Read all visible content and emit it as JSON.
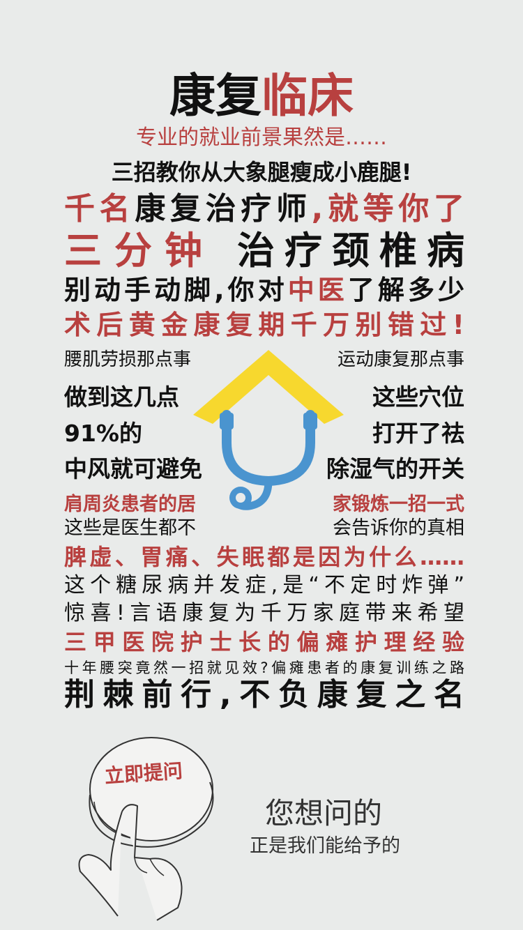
{
  "title": {
    "part1": "康复",
    "part2": "临床"
  },
  "subtitle": "专业的就业前景果然是……",
  "lines": {
    "l1": "三招教你从大象腿瘦成小鹿腿!",
    "l2a": "千名",
    "l2b": "康复治疗师",
    "l2c": ",就等你了",
    "l3a": "三分钟",
    "l3b": "治疗颈椎病",
    "l4a": "别动手动脚,你对",
    "l4b": "中医",
    "l4c": "了解多少",
    "l5": "术后黄金康复期千万别错过!"
  },
  "left_col": {
    "a": "腰肌劳损那点事",
    "b": "做到这几点",
    "c": "91%的",
    "d": "中风就可避免",
    "e": "肩周炎患者的居",
    "f": "这些是医生都不"
  },
  "right_col": {
    "a": "运动康复那点事",
    "b": "这些穴位",
    "c": "打开了祛",
    "d": "除湿气的开关",
    "e": "家锻炼一招一式",
    "f": "会告诉你的真相"
  },
  "lower": {
    "m1": "脾虚、胃痛、失眠都是因为什么……",
    "m2": "这个糖尿病并发症,是“不定时炸弹”",
    "m3": "惊喜!言语康复为千万家庭带来希望",
    "m4": "三甲医院护士长的偏瘫护理经验",
    "m5": "十年腰突竟然一招就见效?偏瘫患者的康复训练之路",
    "m6": "荆棘前行,不负康复之名"
  },
  "cta": {
    "button": "立即提问",
    "line1": "您想问的",
    "line2": "正是我们能给予的"
  },
  "colors": {
    "red": "#b8403f",
    "roof_yellow": "#f7d82e",
    "stethoscope_blue": "#4a94cf",
    "background": "#e9ebea"
  },
  "icons": {
    "logo": "house-stethoscope-icon",
    "hand": "pointing-hand-icon"
  }
}
